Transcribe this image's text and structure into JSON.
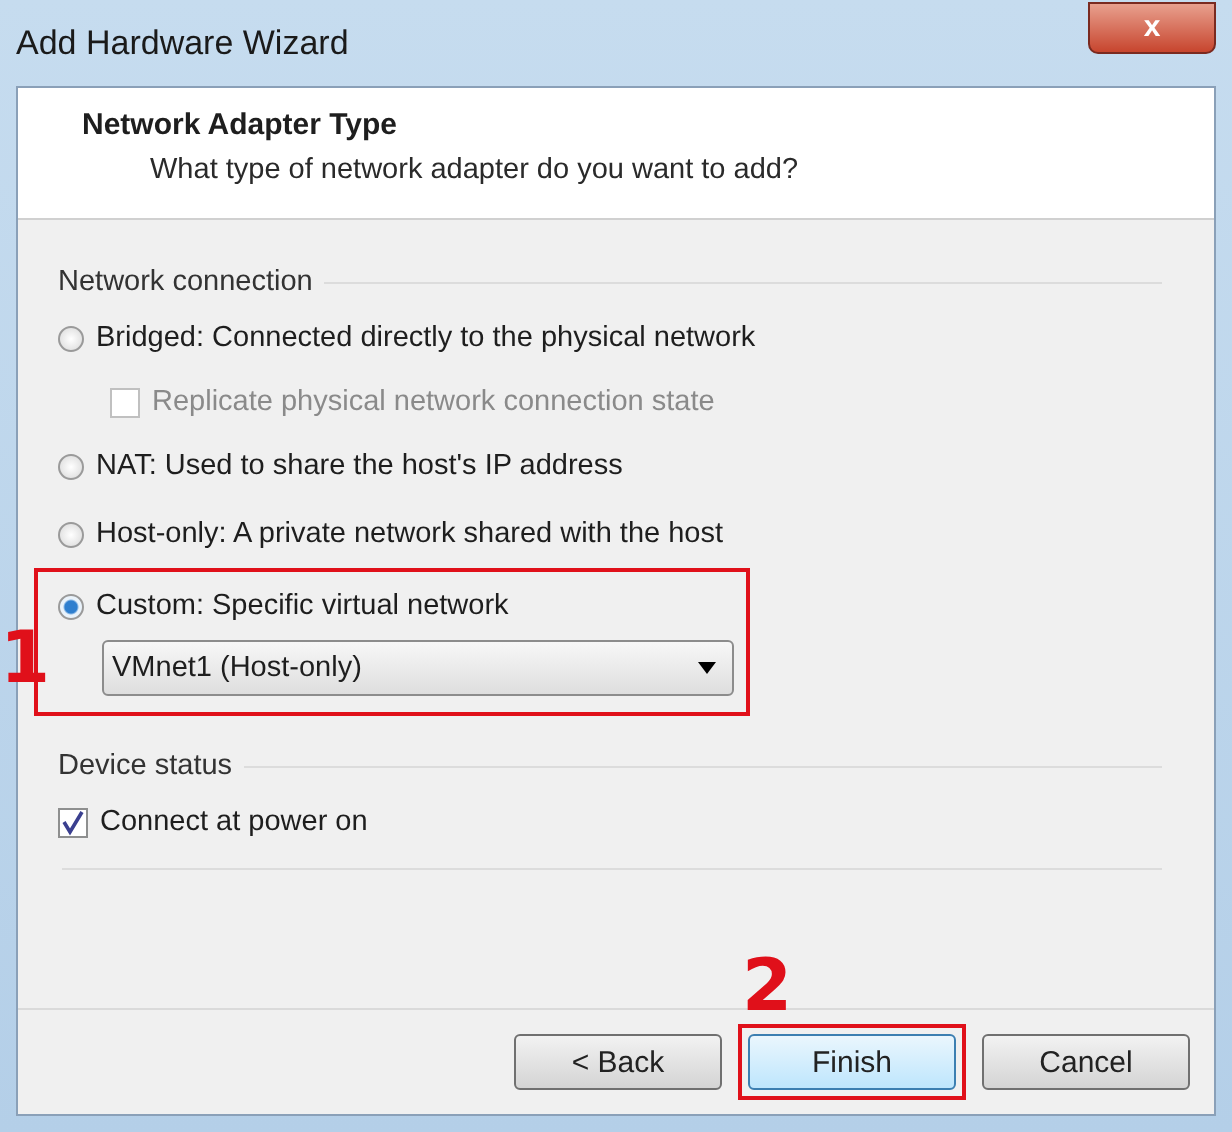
{
  "window": {
    "title": "Add Hardware Wizard",
    "close": "x"
  },
  "header": {
    "title": "Network Adapter Type",
    "subtitle": "What type of network adapter do you want to add?"
  },
  "network_connection": {
    "label": "Network connection",
    "options": [
      {
        "kind": "radio",
        "label": "Bridged: Connected directly to the physical network",
        "selected": false
      },
      {
        "kind": "checkbox",
        "label": "Replicate physical network connection state",
        "checked": false,
        "disabled": true
      },
      {
        "kind": "radio",
        "label": "NAT: Used to share the host's IP address",
        "selected": false
      },
      {
        "kind": "radio",
        "label": "Host-only: A private network shared with the host",
        "selected": false
      },
      {
        "kind": "radio",
        "label": "Custom: Specific virtual network",
        "selected": true,
        "dropdown": "VMnet1 (Host-only)",
        "annotation": "1"
      }
    ]
  },
  "device_status": {
    "label": "Device status",
    "options": [
      {
        "kind": "checkbox",
        "label": "Connect at power on",
        "checked": true,
        "disabled": false
      }
    ]
  },
  "buttons": [
    {
      "label": "< Back",
      "default": false
    },
    {
      "label": "Finish",
      "default": true,
      "annotation": "2"
    },
    {
      "label": "Cancel",
      "default": false
    }
  ]
}
